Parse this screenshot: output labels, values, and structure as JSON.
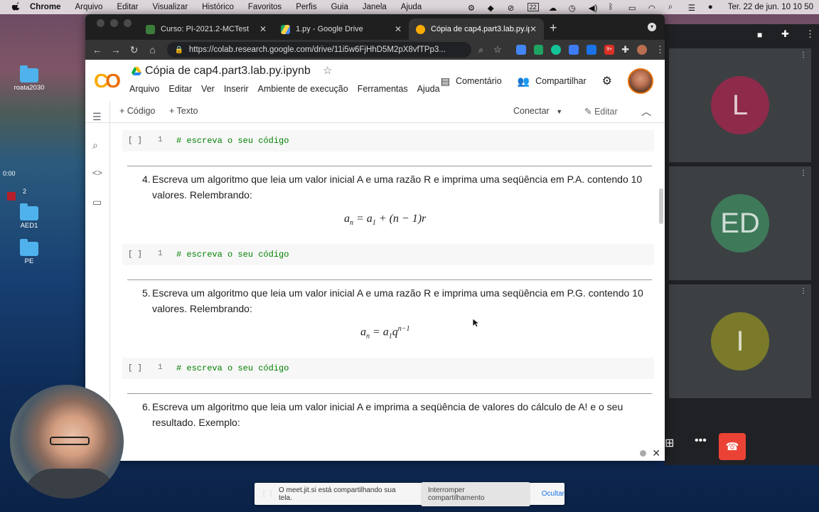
{
  "menubar": {
    "app": "Chrome",
    "items": [
      "Arquivo",
      "Editar",
      "Visualizar",
      "Histórico",
      "Favoritos",
      "Perfis",
      "Guia",
      "Janela",
      "Ajuda"
    ],
    "calendar_day": "22",
    "datetime": "Ter. 22 de jun.  10 10 50"
  },
  "desktop": {
    "icons": [
      {
        "label": "roata2030"
      },
      {
        "label": "AED1"
      },
      {
        "label": "PE"
      }
    ],
    "recording_time": "0:00",
    "partial_label": "2"
  },
  "browser": {
    "tabs": [
      {
        "title": "Curso: PI-2021.2-MCTest",
        "active": false
      },
      {
        "title": "1.py - Google Drive",
        "active": false
      },
      {
        "title": "Cópia de cap4.part3.lab.py.ipy",
        "active": true
      }
    ],
    "url": "https://colab.research.google.com/drive/11i5w6FjHhD5M2pX8vfTPp3...",
    "ext_badge": "9+"
  },
  "colab": {
    "title": "Cópia de cap4.part3.lab.py.ipynb",
    "menus": [
      "Arquivo",
      "Editar",
      "Ver",
      "Inserir",
      "Ambiente de execução",
      "Ferramentas",
      "Ajuda"
    ],
    "comment_label": "Comentário",
    "share_label": "Compartilhar",
    "add_code": "+ Código",
    "add_text": "+ Texto",
    "connect": "Conectar",
    "edit": "Editar",
    "cells": [
      {
        "brackets": "[ ]",
        "line": "1",
        "code": "# escreva o seu código"
      },
      {
        "brackets": "[ ]",
        "line": "1",
        "code": "# escreva o seu código"
      },
      {
        "brackets": "[ ]",
        "line": "1",
        "code": "# escreva o seu código"
      }
    ],
    "texts": [
      {
        "num": "4.",
        "text": "Escreva um algoritmo que leia um valor inicial A e uma razão R e imprima uma seqüência em P.A. contendo 10 valores. Relembrando:"
      },
      {
        "num": "5.",
        "text": "Escreva um algoritmo que leia um valor inicial A e uma razão R e imprima uma seqüência em P.G. contendo 10 valores. Relembrando:"
      },
      {
        "num": "6.",
        "text": "Escreva um algoritmo que leia um valor inicial A e imprima a seqüência de valores do cálculo de A! e o seu resultado. Exemplo:"
      }
    ]
  },
  "meet": {
    "participants": [
      {
        "initials": "L",
        "color": "#8e2a4a"
      },
      {
        "initials": "ED",
        "color": "#3e7a5a"
      },
      {
        "initials": "I",
        "color": "#7a7a2a"
      }
    ]
  },
  "share_banner": {
    "message": "O meet.jit.si está compartilhando sua tela.",
    "stop": "Interromper compartilhamento",
    "hide": "Ocultar"
  }
}
